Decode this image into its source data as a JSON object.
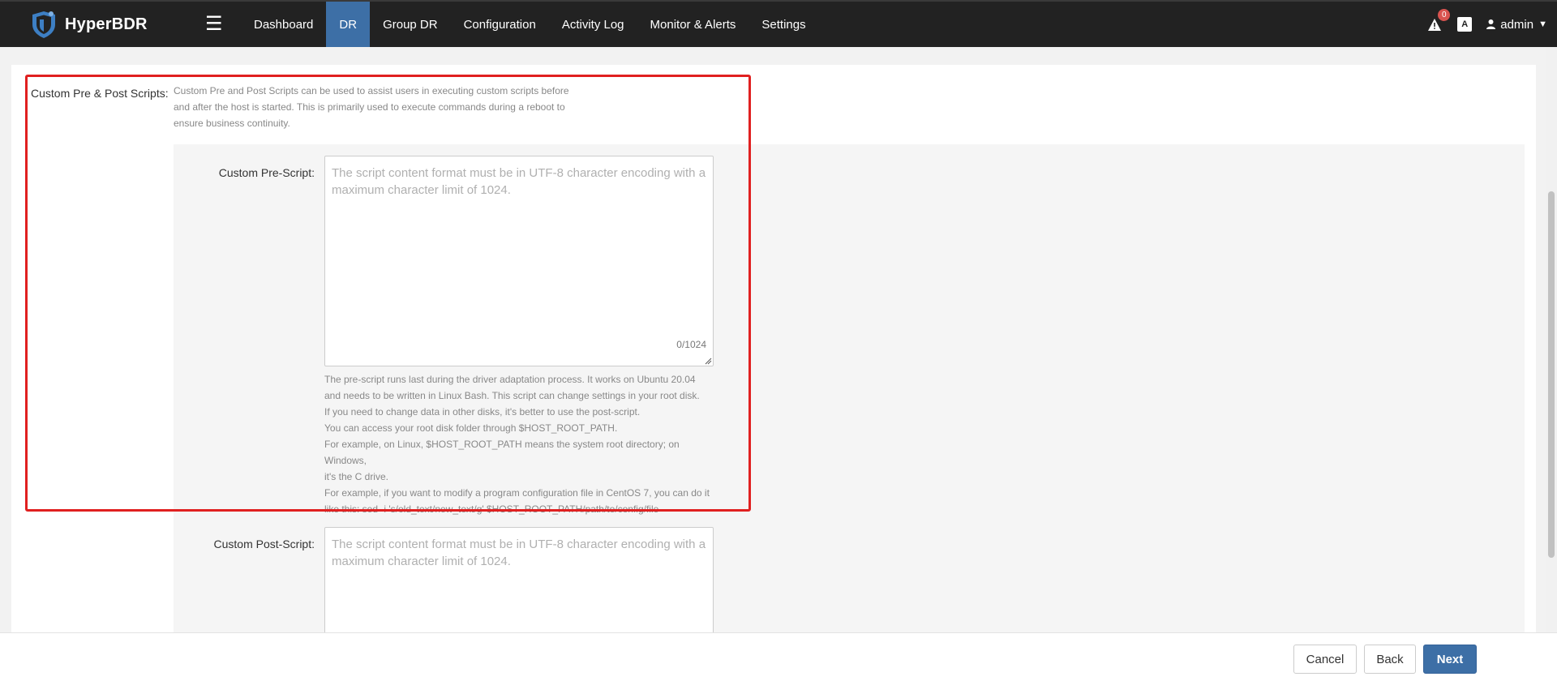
{
  "app": {
    "brand": "HyperBDR"
  },
  "nav": {
    "items": [
      {
        "label": "Dashboard",
        "active": false
      },
      {
        "label": "DR",
        "active": true
      },
      {
        "label": "Group DR",
        "active": false
      },
      {
        "label": "Configuration",
        "active": false
      },
      {
        "label": "Activity Log",
        "active": false
      },
      {
        "label": "Monitor & Alerts",
        "active": false
      },
      {
        "label": "Settings",
        "active": false
      }
    ]
  },
  "header": {
    "alert_count": "0",
    "user": "admin",
    "lang_icon_label": "A"
  },
  "section": {
    "label": "Custom Pre & Post Scripts:",
    "description": "Custom Pre and Post Scripts can be used to assist users in executing custom scripts before and after the host is started. This is primarily used to execute commands during a reboot to ensure business continuity."
  },
  "pre_script": {
    "label": "Custom Pre-Script:",
    "placeholder": "The script content format must be in UTF-8 character encoding with a maximum character limit of 1024.",
    "counter": "0/1024",
    "help": [
      "The pre-script runs last during the driver adaptation process. It works on Ubuntu 20.04",
      "and needs to be written in Linux Bash. This script can change settings in your root disk.",
      "If you need to change data in other disks, it's better to use the post-script.",
      "You can access your root disk folder through $HOST_ROOT_PATH.",
      "For example, on Linux, $HOST_ROOT_PATH means the system root directory; on Windows,",
      "it's the C drive.",
      "For example, if you want to modify a program configuration file in CentOS 7, you can do it",
      "like this: sed -i 's/old_text/new_text/g' $HOST_ROOT_PATH/path/to/config/file"
    ]
  },
  "post_script": {
    "label": "Custom Post-Script:",
    "placeholder": "The script content format must be in UTF-8 character encoding with a maximum character limit of 1024."
  },
  "footer": {
    "cancel": "Cancel",
    "back": "Back",
    "next": "Next"
  },
  "colors": {
    "nav_bg": "#222222",
    "accent": "#3d6fa6",
    "highlight": "#e02020"
  }
}
